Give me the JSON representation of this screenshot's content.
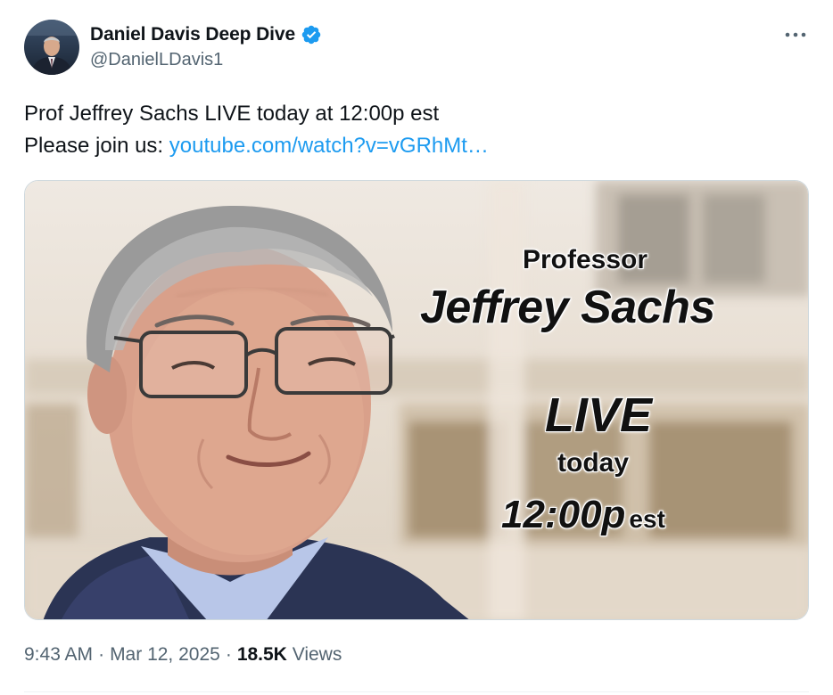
{
  "author": {
    "display_name": "Daniel Davis Deep Dive",
    "handle": "@DanielLDavis1",
    "verified": true,
    "avatar_icon": "avatar-icon"
  },
  "tweet": {
    "line1": "Prof Jeffrey Sachs LIVE today at 12:00p est",
    "line2_prefix": "Please join us: ",
    "link_text": "youtube.com/watch?v=vGRhMt…"
  },
  "media": {
    "heading": "Professor",
    "name": "Jeffrey Sachs",
    "live": "LIVE",
    "today": "today",
    "time": "12:00p",
    "tz": "est"
  },
  "meta": {
    "time": "9:43 AM",
    "date": "Mar 12, 2025",
    "views_count": "18.5K",
    "views_label": "Views"
  },
  "colors": {
    "accent": "#1d9bf0",
    "text_primary": "#0f1419",
    "text_secondary": "#536471"
  },
  "icons": {
    "verified": "verified-badge-icon",
    "more": "more-horizontal-icon"
  }
}
